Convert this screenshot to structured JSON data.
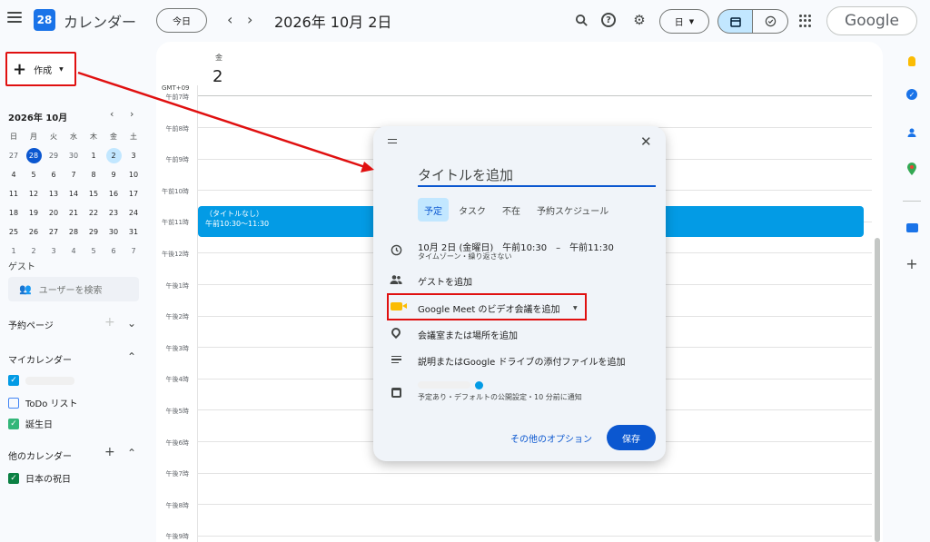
{
  "topbar": {
    "app_name": "カレンダー",
    "logo_day": "28",
    "today_label": "今日",
    "prev_icon": "chevron-left-icon",
    "next_icon": "chevron-right-icon",
    "current_date": "2026年 10月 2日",
    "view_label": "日",
    "brand": "Google"
  },
  "sidebar": {
    "create_label": "作成",
    "mini_calendar": {
      "title": "2026年 10月",
      "weekdays": [
        "日",
        "月",
        "火",
        "水",
        "木",
        "金",
        "土"
      ],
      "weeks": [
        [
          "27",
          "28",
          "29",
          "30",
          "1",
          "2",
          "3"
        ],
        [
          "4",
          "5",
          "6",
          "7",
          "8",
          "9",
          "10"
        ],
        [
          "11",
          "12",
          "13",
          "14",
          "15",
          "16",
          "17"
        ],
        [
          "18",
          "19",
          "20",
          "21",
          "22",
          "23",
          "24"
        ],
        [
          "25",
          "26",
          "27",
          "28",
          "29",
          "30",
          "31"
        ],
        [
          "1",
          "2",
          "3",
          "4",
          "5",
          "6",
          "7"
        ]
      ]
    },
    "guest_label": "ゲスト",
    "user_search_placeholder": "ユーザーを検索",
    "booking_pages_label": "予約ページ",
    "my_calendars_label": "マイカレンダー",
    "my_calendars": [
      {
        "label": "",
        "color": "#039be5",
        "checked": true
      },
      {
        "label": "ToDo リスト",
        "color": "#4285f4",
        "checked": false
      },
      {
        "label": "誕生日",
        "color": "#33b679",
        "checked": true
      }
    ],
    "other_calendars_label": "他のカレンダー",
    "other_calendars": [
      {
        "label": "日本の祝日",
        "color": "#0b8043",
        "checked": true
      }
    ]
  },
  "day_view": {
    "weekday": "金",
    "day_number": "2",
    "timezone": "GMT+09",
    "hours": [
      "午前7時",
      "午前8時",
      "午前9時",
      "午前10時",
      "午前11時",
      "午後12時",
      "午後1時",
      "午後2時",
      "午後3時",
      "午後4時",
      "午後5時",
      "午後6時",
      "午後7時",
      "午後8時",
      "午後9時"
    ],
    "event": {
      "title": "（タイトルなし）",
      "time": "午前10:30～11:30",
      "color": "#039be5"
    }
  },
  "dialog": {
    "title_placeholder": "タイトルを追加",
    "tabs": [
      "予定",
      "タスク",
      "不在",
      "予約スケジュール"
    ],
    "active_tab": "予定",
    "datetime": "10月 2日 (金曜日)　午前10:30　–　午前11:30",
    "datetime_sub": "タイムゾーン・繰り返さない",
    "add_guests": "ゲストを追加",
    "meet_label": "Google Meet のビデオ会議を追加",
    "location": "会議室または場所を追加",
    "description": "説明またはGoogle ドライブの添付ファイルを追加",
    "calendar_sub": "予定あり・デフォルトの公開設定・10 分前に通知",
    "more_options": "その他のオプション",
    "save_label": "保存"
  },
  "colors": {
    "accent": "#0b57d0",
    "highlight_red": "#e01010",
    "event_blue": "#039be5"
  }
}
